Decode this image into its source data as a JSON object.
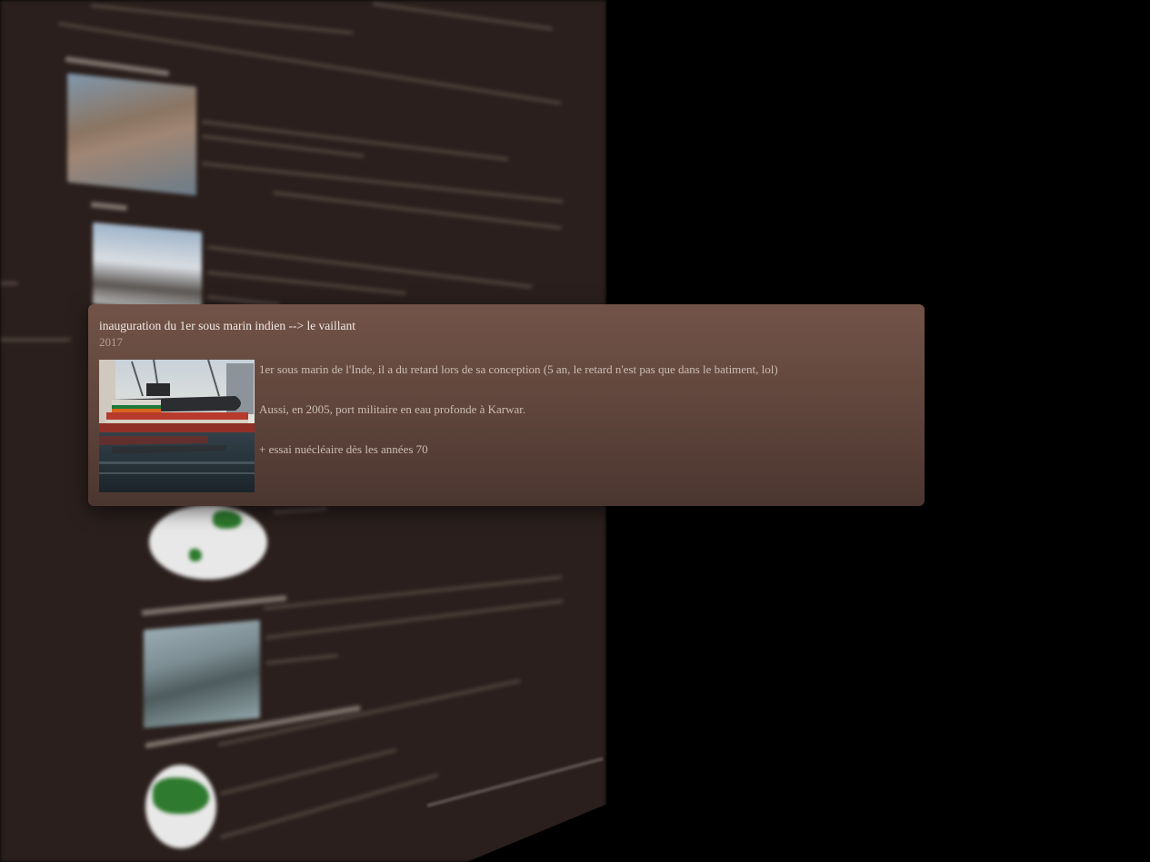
{
  "popup": {
    "title": "inauguration du 1er sous marin indien --> le vaillant",
    "year": "2017",
    "image_alt": "submarine-launch-photo",
    "paragraphs": [
      "1er sous marin de l'Inde, il a du retard lors de sa conception (5 an, le retard n'est pas que dans le batiment, lol)",
      "Aussi, en 2005, port militaire en eau profonde à Karwar.",
      "+ essai nuécléaire dès les années 70"
    ]
  },
  "colors": {
    "page_background": "#000000",
    "panel_background": "#2a1f1c",
    "popup_top": "#725348",
    "popup_bottom": "#4b3630",
    "popup_title_text": "#f1e9e5",
    "popup_year_text": "#b49e95",
    "popup_body_text": "#cdbdb5",
    "globe_land": "#2e7a2e"
  }
}
